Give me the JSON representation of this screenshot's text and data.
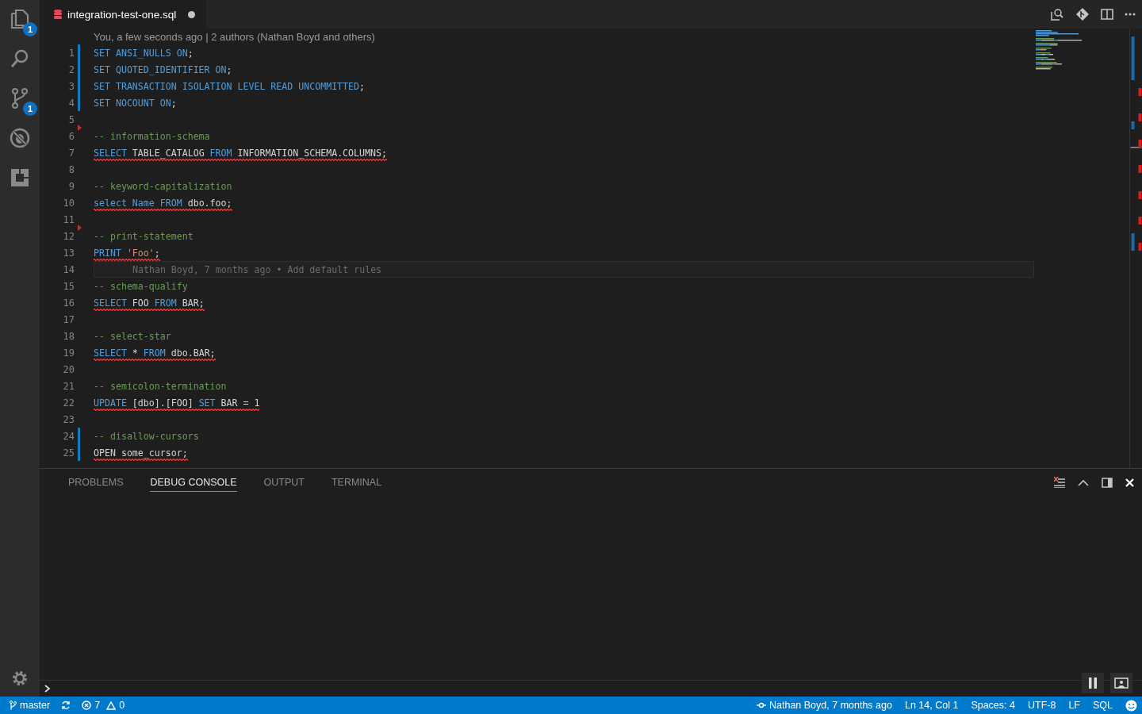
{
  "activity_bar": {
    "items": [
      {
        "kind": "files",
        "badge": "1"
      },
      {
        "kind": "search"
      },
      {
        "kind": "source-control",
        "badge": "1"
      },
      {
        "kind": "debug"
      },
      {
        "kind": "extensions"
      }
    ]
  },
  "tabs": [
    {
      "title": "integration-test-one.sql",
      "dirty": true,
      "selected": true
    }
  ],
  "editor": {
    "codelens": "You, a few seconds ago | 2 authors (Nathan Boyd and others)",
    "lines": [
      {
        "number": "1",
        "modified": true,
        "tokens": [
          {
            "text": "SET ANSI_NULLS ON",
            "kind": "keyword"
          },
          {
            "text": ";",
            "kind": "plain"
          }
        ]
      },
      {
        "number": "2",
        "modified": true,
        "tokens": [
          {
            "text": "SET QUOTED_IDENTIFIER ON",
            "kind": "keyword"
          },
          {
            "text": ";",
            "kind": "plain"
          }
        ]
      },
      {
        "number": "3",
        "modified": true,
        "tokens": [
          {
            "text": "SET TRANSACTION ISOLATION LEVEL READ UNCOMMITTED",
            "kind": "keyword"
          },
          {
            "text": ";",
            "kind": "plain"
          }
        ]
      },
      {
        "number": "4",
        "modified": true,
        "tokens": [
          {
            "text": "SET NOCOUNT ON",
            "kind": "keyword"
          },
          {
            "text": ";",
            "kind": "plain"
          }
        ]
      },
      {
        "number": "5"
      },
      {
        "number": "6",
        "deleted": true,
        "tokens": [
          {
            "text": "-- information-schema",
            "kind": "comment"
          }
        ]
      },
      {
        "number": "7",
        "error": true,
        "tokens": [
          {
            "text": "SELECT",
            "kind": "keyword"
          },
          {
            "text": " TABLE_CATALOG ",
            "kind": "plain"
          },
          {
            "text": "FROM",
            "kind": "keyword"
          },
          {
            "text": " INFORMATION_SCHEMA.COLUMNS;",
            "kind": "plain"
          }
        ]
      },
      {
        "number": "8"
      },
      {
        "number": "9",
        "tokens": [
          {
            "text": "-- keyword-capitalization",
            "kind": "comment"
          }
        ]
      },
      {
        "number": "10",
        "error": true,
        "tokens": [
          {
            "text": "select Name FROM",
            "kind": "keyword"
          },
          {
            "text": " dbo.foo;",
            "kind": "plain"
          }
        ]
      },
      {
        "number": "11"
      },
      {
        "number": "12",
        "deleted": true,
        "tokens": [
          {
            "text": "-- print-statement",
            "kind": "comment"
          }
        ]
      },
      {
        "number": "13",
        "error": true,
        "tokens": [
          {
            "text": "PRINT",
            "kind": "keyword"
          },
          {
            "text": " 'Foo'",
            "kind": "string"
          },
          {
            "text": ";",
            "kind": "plain"
          }
        ]
      },
      {
        "number": "14",
        "current": true,
        "annotation": "Nathan Boyd, 7 months ago • Add default rules"
      },
      {
        "number": "15",
        "tokens": [
          {
            "text": "-- schema-qualify",
            "kind": "comment"
          }
        ]
      },
      {
        "number": "16",
        "error": true,
        "tokens": [
          {
            "text": "SELECT",
            "kind": "keyword"
          },
          {
            "text": " FOO ",
            "kind": "plain"
          },
          {
            "text": "FROM",
            "kind": "keyword"
          },
          {
            "text": " BAR;",
            "kind": "plain"
          }
        ]
      },
      {
        "number": "17"
      },
      {
        "number": "18",
        "tokens": [
          {
            "text": "-- select-star",
            "kind": "comment"
          }
        ]
      },
      {
        "number": "19",
        "error": true,
        "tokens": [
          {
            "text": "SELECT",
            "kind": "keyword"
          },
          {
            "text": " * ",
            "kind": "plain"
          },
          {
            "text": "FROM",
            "kind": "keyword"
          },
          {
            "text": " dbo.BAR;",
            "kind": "plain"
          }
        ]
      },
      {
        "number": "20"
      },
      {
        "number": "21",
        "tokens": [
          {
            "text": "-- semicolon-termination",
            "kind": "comment"
          }
        ]
      },
      {
        "number": "22",
        "error": true,
        "tokens": [
          {
            "text": "UPDATE",
            "kind": "keyword"
          },
          {
            "text": " [dbo].[FOO] ",
            "kind": "plain"
          },
          {
            "text": "SET",
            "kind": "keyword"
          },
          {
            "text": " BAR = 1",
            "kind": "plain"
          }
        ]
      },
      {
        "number": "23"
      },
      {
        "number": "24",
        "modified": true,
        "tokens": [
          {
            "text": "-- disallow-cursors",
            "kind": "comment"
          }
        ]
      },
      {
        "number": "25",
        "modified": true,
        "error": true,
        "tokens": [
          {
            "text": "OPEN some_cursor;",
            "kind": "plain"
          }
        ]
      }
    ]
  },
  "panel": {
    "tabs": [
      {
        "label": "PROBLEMS",
        "selected": false
      },
      {
        "label": "DEBUG CONSOLE",
        "selected": true
      },
      {
        "label": "OUTPUT",
        "selected": false
      },
      {
        "label": "TERMINAL",
        "selected": false
      }
    ]
  },
  "status_bar": {
    "branch": "master",
    "errors": "7",
    "warnings": "0",
    "blame": "Nathan Boyd, 7 months ago",
    "position": "Ln 14, Col 1",
    "indentation": "Spaces: 4",
    "encoding": "UTF-8",
    "eol": "LF",
    "language": "SQL"
  }
}
